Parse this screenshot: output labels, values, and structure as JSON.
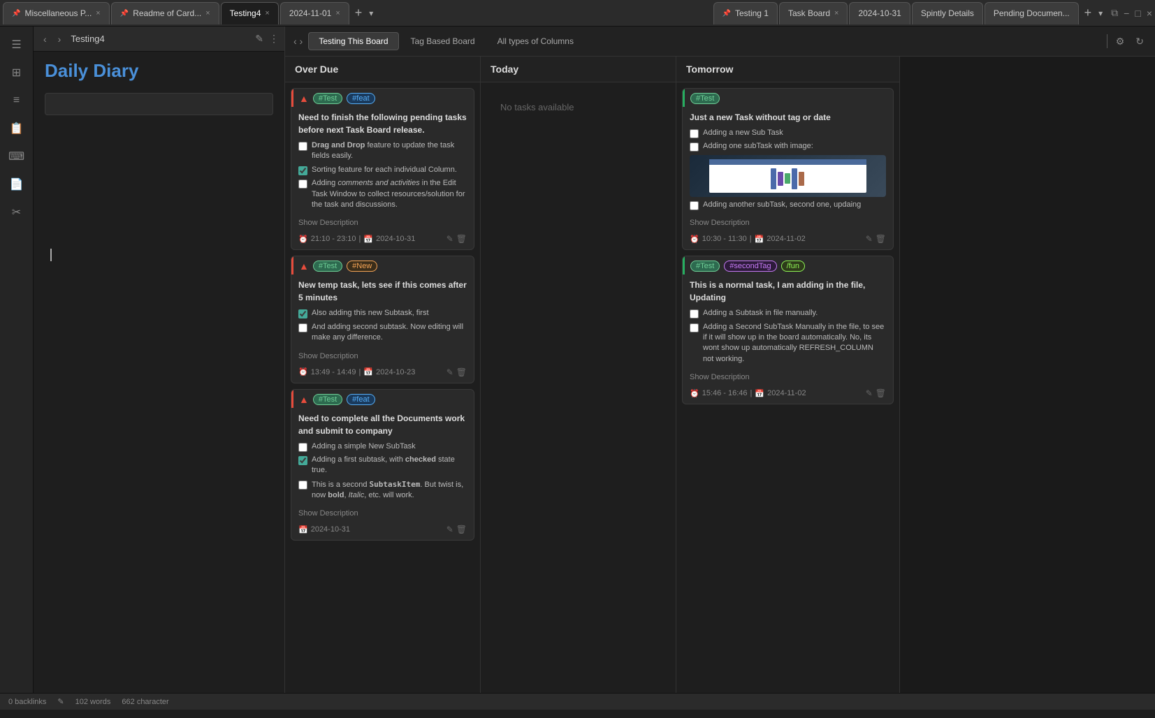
{
  "tabs": [
    {
      "label": "Miscellaneous P...",
      "pinned": true,
      "active": false,
      "closeable": true
    },
    {
      "label": "Readme of Card...",
      "pinned": true,
      "active": false,
      "closeable": true
    },
    {
      "label": "Testing4",
      "pinned": false,
      "active": true,
      "closeable": true
    },
    {
      "label": "2024-11-01",
      "pinned": false,
      "active": false,
      "closeable": true
    },
    {
      "label": "Testing 1",
      "pinned": true,
      "active": false,
      "closeable": false
    },
    {
      "label": "Task Board",
      "pinned": false,
      "active": false,
      "closeable": true
    },
    {
      "label": "2024-10-31",
      "pinned": false,
      "active": false,
      "closeable": false
    },
    {
      "label": "Spintly Details",
      "pinned": false,
      "active": false,
      "closeable": false
    },
    {
      "label": "Pending Documen...",
      "pinned": false,
      "active": false,
      "closeable": false
    }
  ],
  "toolbar": {
    "title": "Testing4",
    "back_label": "‹",
    "forward_label": "›",
    "edit_icon": "✎",
    "more_icon": "⋮"
  },
  "taskboard": {
    "header_title": "Task Board",
    "tabs": [
      {
        "label": "Testing This Board",
        "active": true
      },
      {
        "label": "Tag Based Board",
        "active": false
      },
      {
        "label": "All types of Columns",
        "active": false
      }
    ],
    "controls": {
      "divider": true,
      "settings_icon": "⚙",
      "refresh_icon": "↻"
    }
  },
  "columns": [
    {
      "title": "Over Due",
      "cards": [
        {
          "priority": "↑",
          "tags": [
            {
              "label": "#Test",
              "class": "tag-test"
            },
            {
              "label": "#feat",
              "class": "tag-feat"
            }
          ],
          "title": "Need to finish the following pending tasks before next Task Board release.",
          "subtasks": [
            {
              "checked": false,
              "text": "Drag and Drop feature to update the task fields easily.",
              "bold_prefix": "Drag and Drop"
            },
            {
              "checked": true,
              "text": "Sorting feature for each individual Column."
            },
            {
              "checked": false,
              "text": "Adding comments and activities in the Edit Task Window to collect resources/solution for the task and discussions.",
              "italic_parts": "comments and activities"
            }
          ],
          "show_description": "Show Description",
          "time": "21:10 - 23:10",
          "date": "2024-10-31",
          "has_edit": true,
          "has_delete": true
        },
        {
          "priority": "↑",
          "tags": [
            {
              "label": "#Test",
              "class": "tag-test"
            },
            {
              "label": "#New",
              "class": "tag-new"
            }
          ],
          "title": "New temp task, lets see if this comes after 5 minutes",
          "subtasks": [
            {
              "checked": true,
              "text": "Also adding this new Subtask, first"
            },
            {
              "checked": false,
              "text": "And adding second subtask. Now editing will make any difference."
            }
          ],
          "show_description": "Show Description",
          "time": "13:49 - 14:49",
          "date": "2024-10-23",
          "has_edit": true,
          "has_delete": true
        },
        {
          "priority": "↑",
          "tags": [
            {
              "label": "#Test",
              "class": "tag-test"
            },
            {
              "label": "#feat",
              "class": "tag-feat"
            }
          ],
          "title": "Need to complete all the Documents work and submit to company",
          "subtasks": [
            {
              "checked": false,
              "text": "Adding a simple New SubTask"
            },
            {
              "checked": true,
              "text": "Adding a first subtask, with checked state true.",
              "bold_parts": [
                "checked"
              ]
            },
            {
              "checked": false,
              "text": "This is a second SubtaskItem. But twist is, now bold, Italic, etc. will work.",
              "bold_parts": [
                "SubtaskItem",
                "bold"
              ],
              "italic_parts": [
                "Italic"
              ]
            }
          ],
          "show_description": "Show Description",
          "date": "2024-10-31",
          "has_edit": true,
          "has_delete": true
        }
      ]
    },
    {
      "title": "Today",
      "cards": [],
      "no_tasks": "No tasks available"
    },
    {
      "title": "Tomorrow",
      "cards": [
        {
          "priority": null,
          "tags": [
            {
              "label": "#Test",
              "class": "tag-test"
            }
          ],
          "title": "Just a new Task without tag or date",
          "subtasks": [
            {
              "checked": false,
              "text": "Adding a new Sub Task"
            },
            {
              "checked": false,
              "text": "Adding one subTask with image:",
              "has_image": true
            },
            {
              "checked": false,
              "text": "Adding another subTask, second one, updaing"
            }
          ],
          "show_description": "Show Description",
          "time": "10:30 - 11:30",
          "date": "2024-11-02",
          "has_edit": true,
          "has_delete": true
        },
        {
          "priority": null,
          "tags": [
            {
              "label": "#Test",
              "class": "tag-test"
            },
            {
              "label": "#secondTag",
              "class": "tag-secondtag"
            },
            {
              "label": "/fun",
              "class": "tag-fun"
            }
          ],
          "title": "This is a normal task, I am adding in the file, Updating",
          "subtasks": [
            {
              "checked": false,
              "text": "Adding a Subtask in file manually."
            },
            {
              "checked": false,
              "text": "Adding a Second SubTask Manually in the file, to see if it will show up in the board automatically. No, its wont show up automatically REFRESH_COLUMN not working."
            }
          ],
          "show_description": "Show Description",
          "time": "15:46 - 16:46",
          "date": "2024-11-02",
          "has_edit": true,
          "has_delete": true
        }
      ]
    }
  ],
  "left_panel": {
    "title": "Testing4",
    "diary_heading": "Daily Diary",
    "cursor_char": "I"
  },
  "sidebar_icons": [
    "☰",
    "⊞",
    "☰",
    "📋",
    "⌨",
    "📄",
    "✂"
  ],
  "status_bar": {
    "backlinks": "0 backlinks",
    "edit_icon": "✎",
    "words": "102 words",
    "chars": "662 character"
  }
}
